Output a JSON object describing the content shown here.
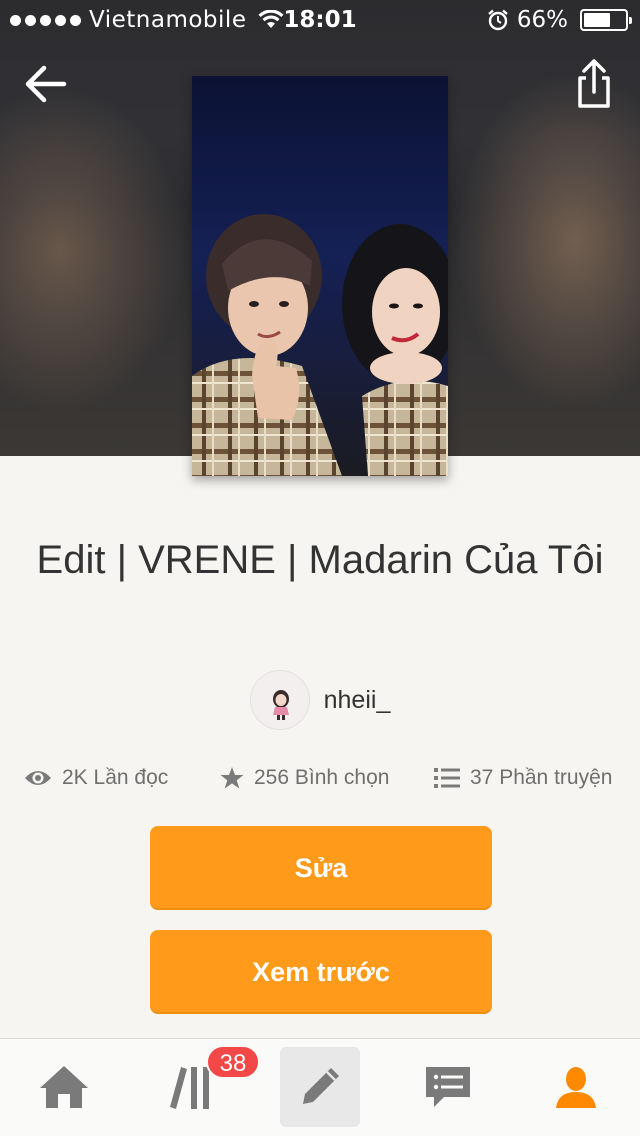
{
  "status_bar": {
    "carrier": "Vietnamobile",
    "time": "18:01",
    "battery_percent": "66%",
    "battery_level": 0.66
  },
  "nav": {
    "back_icon": "arrow-left-icon",
    "share_icon": "share-icon"
  },
  "story": {
    "title": "Edit | VRENE | Madarin Của Tôi",
    "author": "nheii_",
    "stats": {
      "reads": "2K Lần đọc",
      "votes": "256 Bình chọn",
      "parts": "37 Phần truyện"
    }
  },
  "actions": {
    "edit_label": "Sửa",
    "preview_label": "Xem trước"
  },
  "tab_bar": {
    "library_badge": "38",
    "active_tab": "profile",
    "tabs": [
      "home",
      "library",
      "write",
      "messages",
      "profile"
    ]
  },
  "colors": {
    "accent": "#ff9a1a",
    "badge": "#f24848",
    "background": "#f6f5f1",
    "active_tab": "#ff8a00",
    "inactive_tab": "#7a7a7a"
  }
}
